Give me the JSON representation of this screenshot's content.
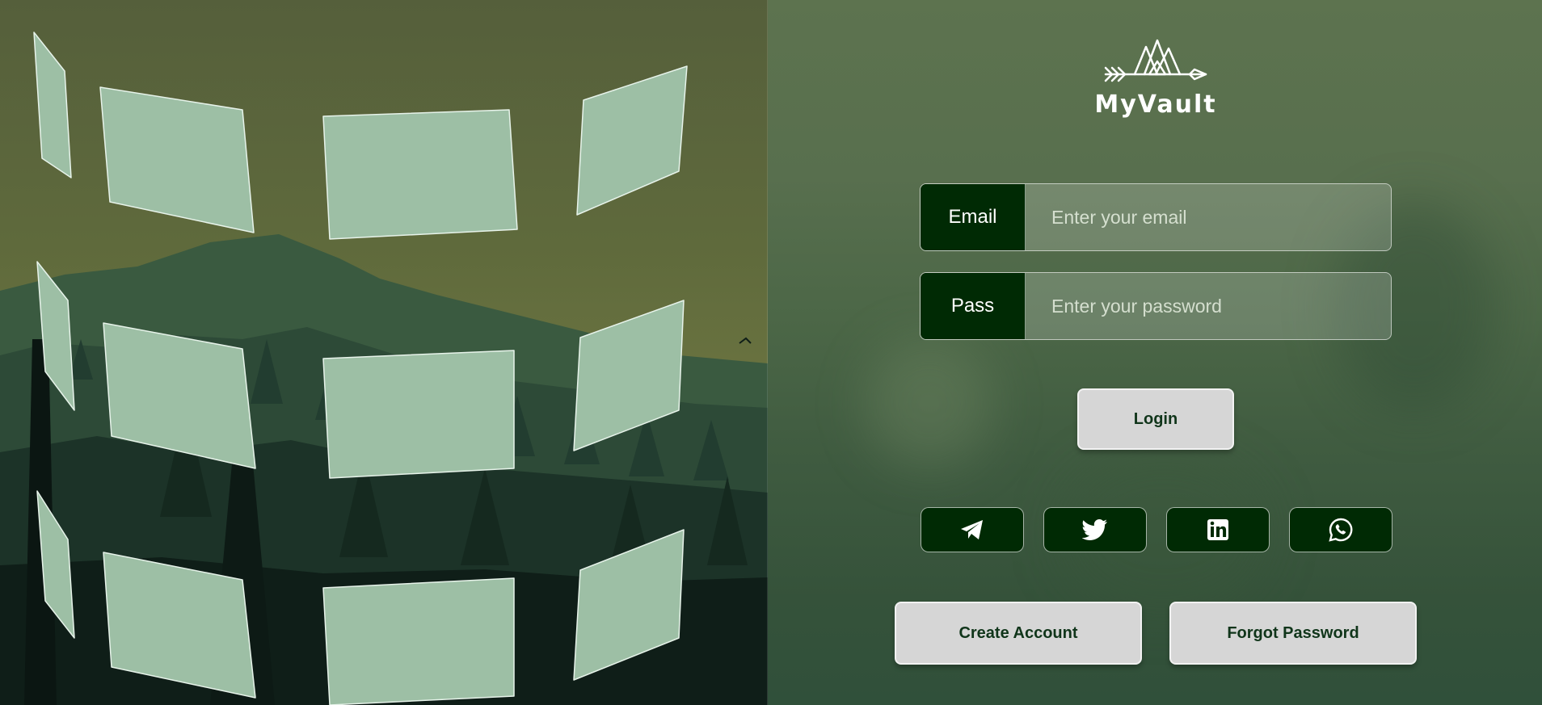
{
  "app": {
    "brand_name": "MyVault",
    "logo_icon": "mountain-arrow-logo",
    "accent_color": "#002a04",
    "panel_color": "#4f6a4a"
  },
  "login_form": {
    "email": {
      "label": "Email",
      "placeholder": "Enter your email",
      "value": ""
    },
    "password": {
      "label": "Pass",
      "placeholder": "Enter your password",
      "value": ""
    },
    "login_button": "Login"
  },
  "social_links": [
    {
      "name": "telegram",
      "icon": "telegram-icon"
    },
    {
      "name": "twitter",
      "icon": "twitter-icon"
    },
    {
      "name": "linkedin",
      "icon": "linkedin-icon"
    },
    {
      "name": "whatsapp",
      "icon": "whatsapp-icon"
    }
  ],
  "footer_actions": {
    "create_account": "Create Account",
    "forgot_password": "Forgot Password"
  },
  "decor": {
    "tile_color": "#9dbfa5",
    "tile_columns": 4,
    "tile_rows": 3
  }
}
